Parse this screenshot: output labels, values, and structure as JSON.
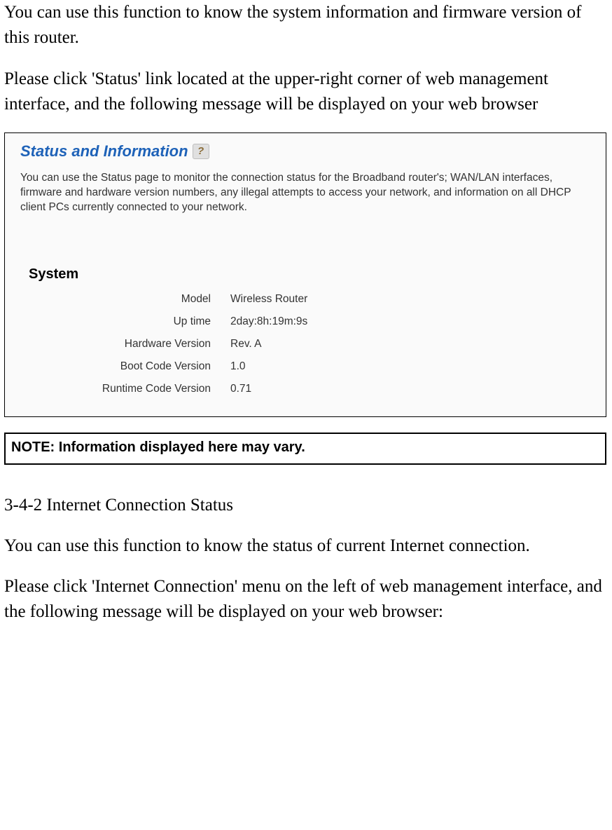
{
  "intro_para_1": "You can use this function to know the system information and firmware version of this router.",
  "intro_para_2": "Please click 'Status' link located at the upper-right corner of web management interface, and the following message will be displayed on your web browser",
  "screenshot": {
    "title": "Status and Information",
    "help_icon": "help-icon",
    "description": "You can use the Status page to monitor the connection status for the Broadband router's; WAN/LAN interfaces, firmware and hardware version numbers, any illegal attempts to access your network, and information on all DHCP client PCs currently connected to your network.",
    "system_heading": "System",
    "rows": [
      {
        "label": "Model",
        "value": "Wireless Router"
      },
      {
        "label": "Up time",
        "value": "2day:8h:19m:9s"
      },
      {
        "label": "Hardware Version",
        "value": "Rev. A"
      },
      {
        "label": "Boot Code Version",
        "value": "1.0"
      },
      {
        "label": "Runtime Code Version",
        "value": "0.71"
      }
    ]
  },
  "note_text": "NOTE: Information displayed here may vary.",
  "section_heading": "3-4-2 Internet Connection Status",
  "section_para_1": "You can use this function to know the status of current Internet connection.",
  "section_para_2": "Please click 'Internet Connection' menu on the left of web management interface, and the following message will be displayed on your web browser:"
}
